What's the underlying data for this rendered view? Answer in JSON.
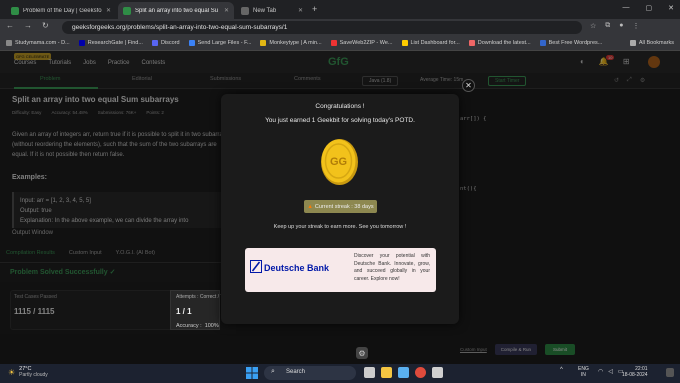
{
  "browser": {
    "tabs": [
      {
        "title": "Problem of the Day | GeeksforG",
        "active": false
      },
      {
        "title": "Split an array into two equal Su",
        "active": true
      },
      {
        "title": "New Tab",
        "active": false
      }
    ],
    "url": "geeksforgeeks.org/problems/split-an-array-into-two-equal-sum-subarrays/1",
    "bookmarks": [
      "Studymama.com - D...",
      "ResearchGate | Find...",
      "Discord",
      "Send Large Files - F...",
      "Monkeytype | A min...",
      "SaveWeb2ZIP - We...",
      "List Dashboard for...",
      "Download the latest...",
      "Best Free Wordpres..."
    ],
    "all_bookmarks": "All Bookmarks"
  },
  "site": {
    "badge": "GFG CELEBRATE",
    "nav": [
      "Courses",
      "Tutorials",
      "Jobs",
      "Practice",
      "Contests"
    ],
    "logo": "GfG",
    "notif_count": "10"
  },
  "problem_tabs": {
    "problem": "Problem",
    "editorial": "Editorial",
    "submissions": "Submissions",
    "comments": "Comments",
    "language": "Java (1.8)",
    "avg_time": "Average Time: 15m",
    "start_timer": "Start Timer"
  },
  "problem": {
    "title": "Split an array into two equal Sum subarrays",
    "difficulty": "Difficulty: Easy",
    "accuracy": "Accuracy: 54.48%",
    "submissions": "Submissions: 76K+",
    "points": "Points: 2",
    "para1": "Given an array of integers arr, return true if it is possible to split it in two subarrays (without reordering the elements), such that the sum of the two subarrays are equal. If it is not possible then return false.",
    "examples_heading": "Examples:",
    "example_input": "Input: arr = [1, 2, 3, 4, 5, 5]",
    "example_output": "Output: true",
    "example_explanation": "Explanation: In the above example, we can divide the array into"
  },
  "output": {
    "window_label": "Output Window",
    "tabs": [
      "Compilation Results",
      "Custom Input",
      "Y.O.G.I. (AI Bot)"
    ],
    "solved": "Problem Solved Successfully",
    "test_cases_label": "Test Cases Passed",
    "test_cases_value": "1115 / 1115",
    "attempts_label": "Attempts : Correct / Total",
    "attempts_value": "1 / 1",
    "accuracy_label": "Accuracy :",
    "accuracy_value": "100%"
  },
  "code": {
    "line1": "arr[]) {",
    "line2": "nt(){"
  },
  "editor_bottom": {
    "custom_input": "Custom Input",
    "compile": "Compile & Run",
    "submit": "Submit"
  },
  "modal": {
    "title": "Congratulations !",
    "earned": "You just earned 1 Geekbit for solving today's POTD.",
    "streak": "Current streak : 38 days",
    "keep_up": "Keep up your streak to earn more. See you tomorrow !",
    "ad_brand": "Deutsche Bank",
    "ad_copy": "Discover your potential with Deutsche Bank. Innovate, grow, and succeed globally in your career. Explore now!"
  },
  "taskbar": {
    "temp": "27°C",
    "weather": "Partly cloudy",
    "search": "Search",
    "lang1": "ENG",
    "lang2": "IN",
    "time": "22:01",
    "date": "18-08-2024"
  },
  "colors": {
    "accent": "#2f8d46",
    "coin": "#f2c21b",
    "streak_bg": "#8d8850",
    "db_blue": "#0018a8"
  }
}
